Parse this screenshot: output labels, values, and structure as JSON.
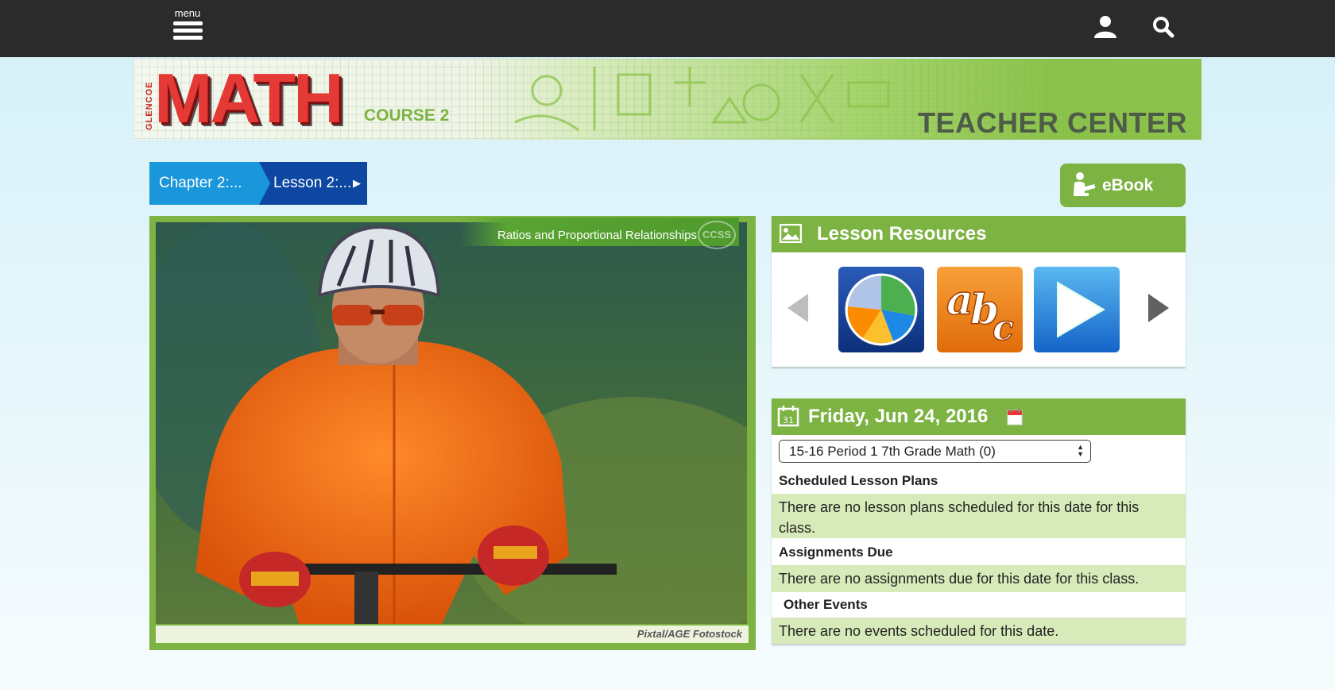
{
  "topbar": {
    "menu_label": "menu",
    "icons": [
      "menu-icon",
      "user-icon",
      "search-icon"
    ]
  },
  "banner": {
    "vertical_text": "GLENCOE",
    "logo_text": "MATH",
    "course": "COURSE 2",
    "title": "TEACHER CENTER"
  },
  "breadcrumb": {
    "chapter": "Chapter 2:...",
    "lesson": "Lesson 2:..."
  },
  "ebook": {
    "label": "eBook"
  },
  "hero": {
    "ribbon_text": "Ratios and Proportional Relationships",
    "badge": "CCSS",
    "credit": "Pixtal/AGE Fotostock"
  },
  "lesson_resources": {
    "title": "Lesson Resources",
    "tiles": [
      "pie-chart-icon",
      "abc-vocabulary-icon",
      "play-video-icon"
    ]
  },
  "calendar": {
    "date": "Friday, Jun 24, 2016",
    "class_select": "15-16 Period 1 7th Grade Math (0)",
    "sections": [
      {
        "heading": "Scheduled Lesson Plans",
        "message": "There are no lesson plans scheduled for this date for this class."
      },
      {
        "heading": "Assignments Due",
        "message": "There are no assignments due for this date for this class."
      },
      {
        "heading": "Other Events",
        "message": "There are no events scheduled for this date."
      }
    ]
  },
  "colors": {
    "topbar": "#2b2b2b",
    "accent_green": "#7cb342",
    "chapter_blue": "#1a96db",
    "lesson_blue": "#0d47a1",
    "message_bg": "#d7eab9"
  }
}
